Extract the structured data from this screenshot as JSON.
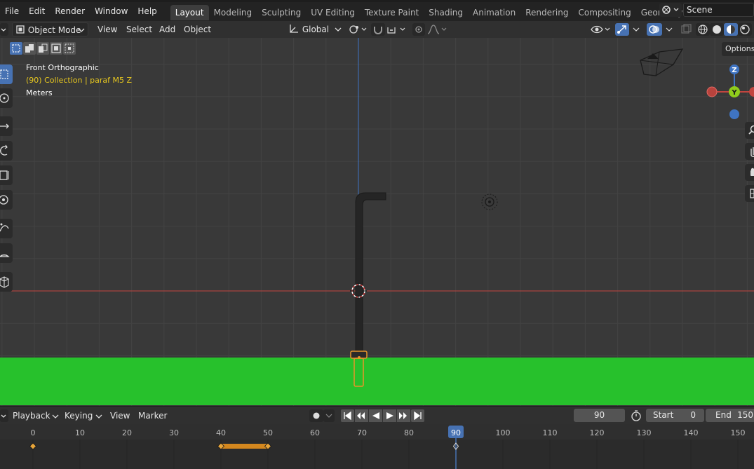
{
  "menu": {
    "file": "File",
    "edit": "Edit",
    "render": "Render",
    "window": "Window",
    "help": "Help"
  },
  "workspaces": {
    "layout": "Layout",
    "modeling": "Modeling",
    "sculpting": "Sculpting",
    "uv_editing": "UV Editing",
    "texture_paint": "Texture Paint",
    "shading": "Shading",
    "animation": "Animation",
    "rendering": "Rendering",
    "compositing": "Compositing",
    "geometry_nodes": "Geometry Noc"
  },
  "scene": {
    "name": "Scene"
  },
  "viewport_header": {
    "mode": "Object Mode",
    "view": "View",
    "select": "Select",
    "add": "Add",
    "object": "Object",
    "transform_orientation": "Global"
  },
  "viewport": {
    "view_name": "Front Orthographic",
    "collection_info": "(90) Collection | paraf M5 Z",
    "units": "Meters",
    "options_label": "Options",
    "gizmo": {
      "z": "Z",
      "y": "Y"
    }
  },
  "timeline": {
    "playback": "Playback",
    "keying": "Keying",
    "view": "View",
    "marker": "Marker",
    "current_frame": "90",
    "start_label": "Start",
    "start_value": "0",
    "end_label": "End",
    "end_value": "150",
    "ruler_labels": [
      "0",
      "10",
      "20",
      "30",
      "40",
      "50",
      "60",
      "70",
      "80",
      "90",
      "100",
      "110",
      "120",
      "130",
      "140",
      "150"
    ]
  },
  "colors": {
    "accent": "#4772b3",
    "ground": "#27c12c",
    "selection": "#e8952a",
    "x_axis": "#c2453f",
    "z_axis": "#3f74c2",
    "y_axis": "#8fcc1c"
  }
}
